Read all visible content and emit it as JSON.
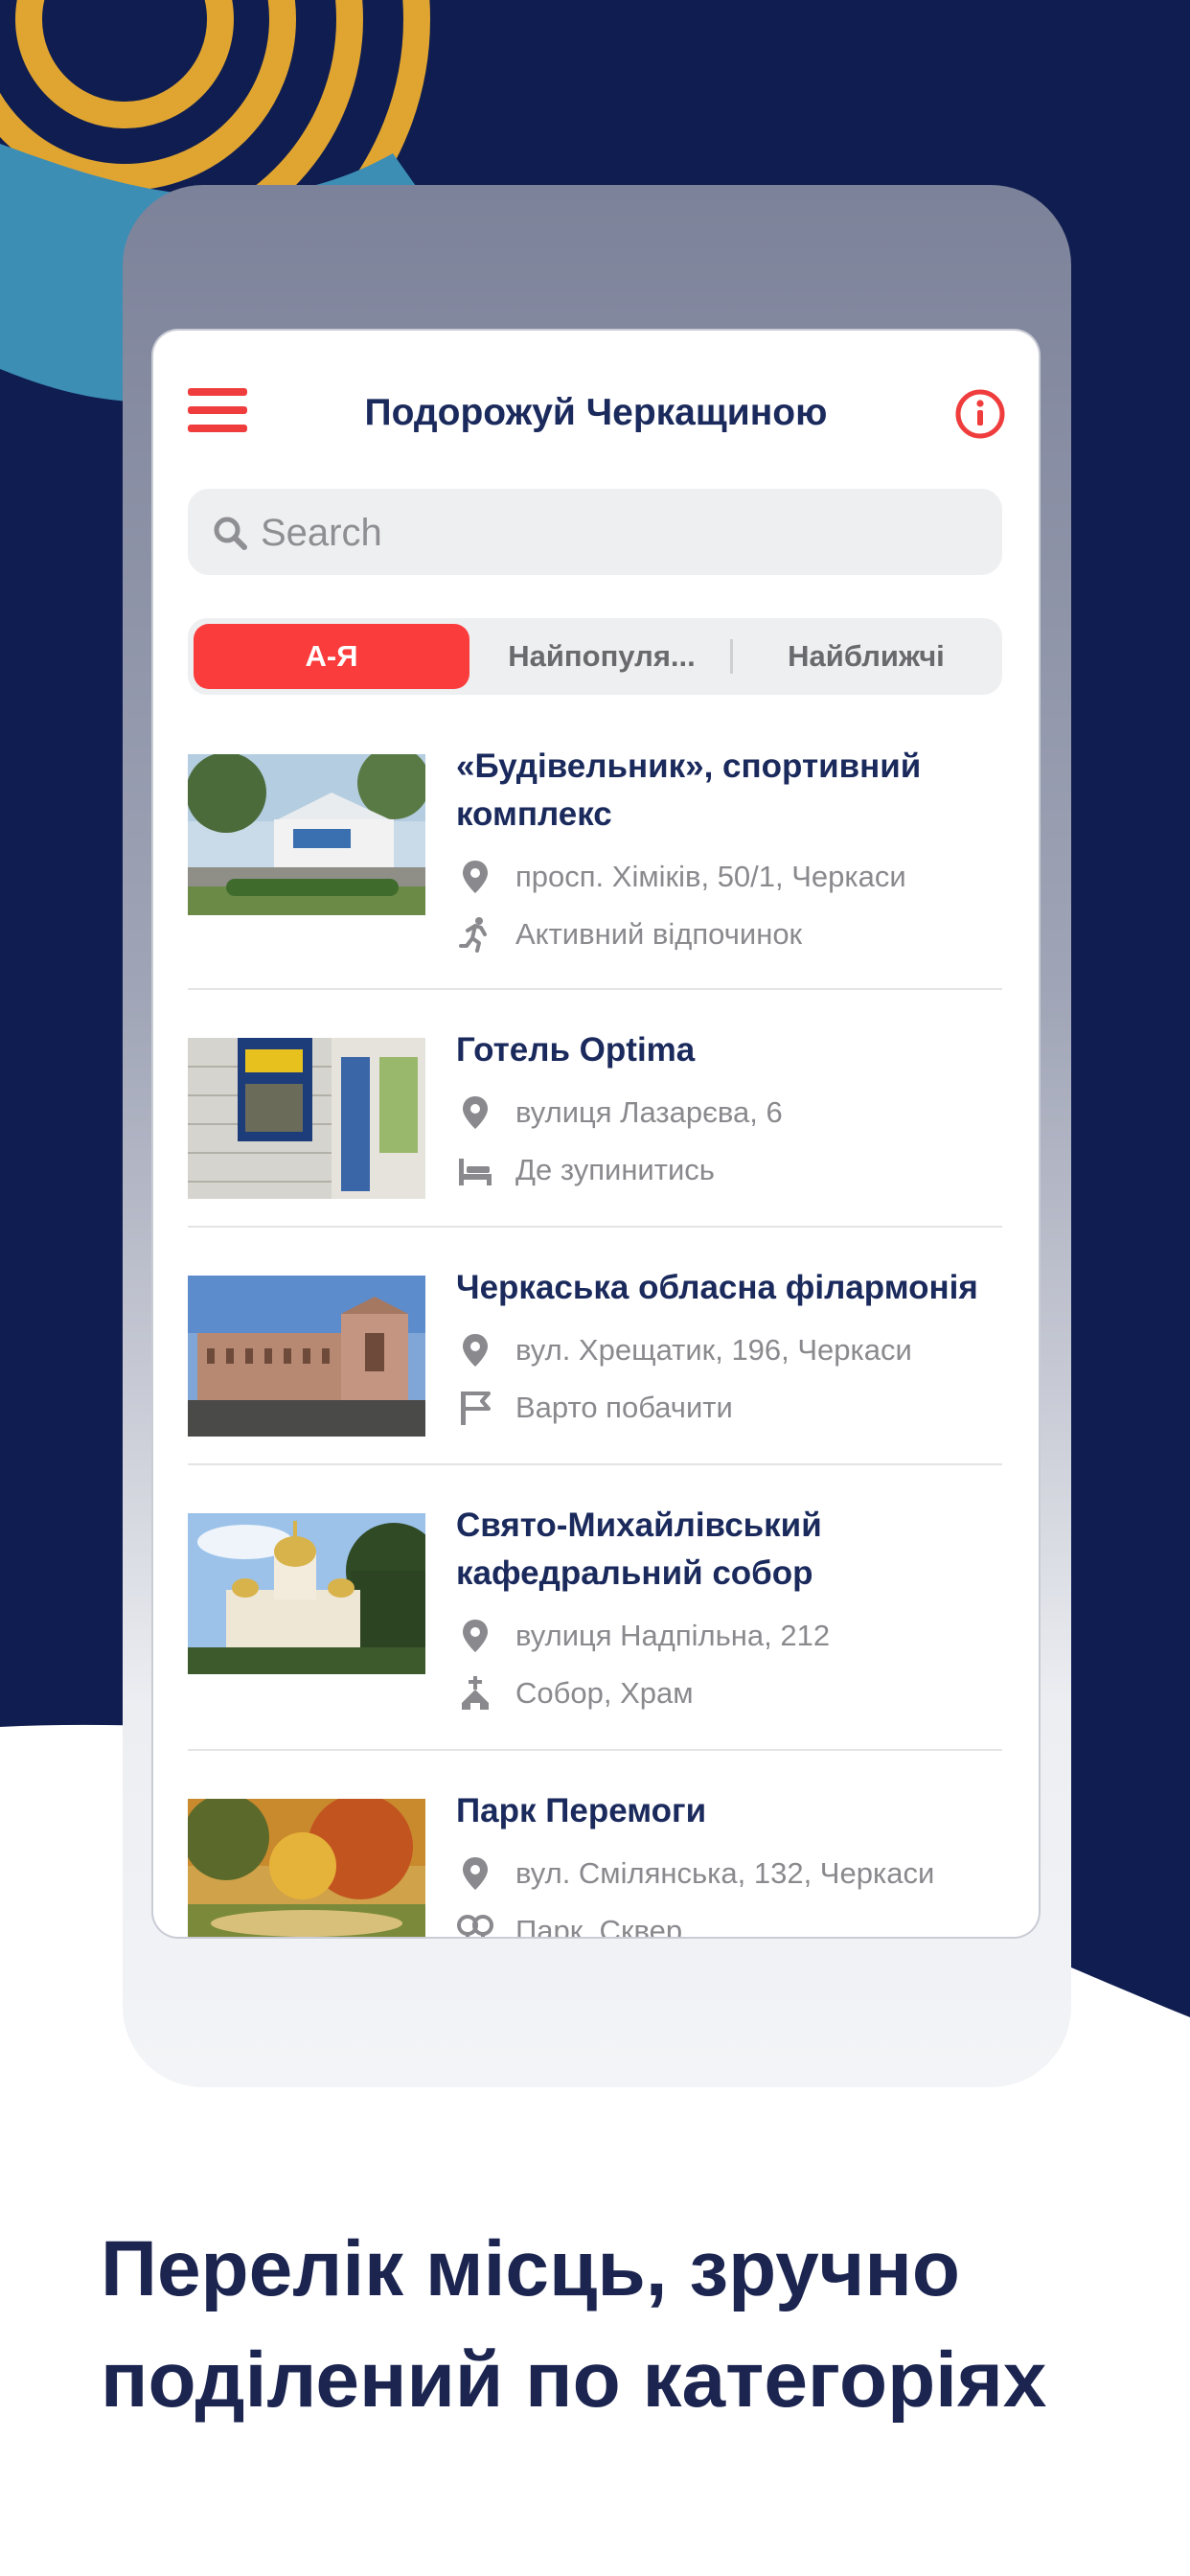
{
  "colors": {
    "navy_background": "#0f1d50",
    "accent_red": "#fb3c3c",
    "title_navy": "#1b2a5c",
    "ring_gold": "#e0a531",
    "ribbon_blue": "#3c8eb5"
  },
  "app": {
    "title": "Подорожуй Черкащиною",
    "menu_icon": "hamburger-icon",
    "info_icon": "info-icon"
  },
  "search": {
    "placeholder": "Search",
    "value": ""
  },
  "segments": {
    "items": [
      "А-Я",
      "Найпопуля...",
      "Найближчі"
    ],
    "selected": "А-Я"
  },
  "places": [
    {
      "title": "«Будівельник», спортивний комплекс",
      "address": "просп. Хіміків, 50/1, Черкаси",
      "category": "Активний відпочинок",
      "category_icon": "running-person-icon"
    },
    {
      "title": "Готель Optima",
      "address": "вулиця Лазарєва, 6",
      "category": "Де зупинитись",
      "category_icon": "bed-icon"
    },
    {
      "title": "Черкаська обласна філармонія",
      "address": "вул. Хрещатик, 196, Черкаси",
      "category": "Варто побачити",
      "category_icon": "flag-icon"
    },
    {
      "title": "Свято-Михайлівський кафедральний собор",
      "address": "вулиця Надпільна, 212",
      "category": "Собор, Храм",
      "category_icon": "church-icon"
    },
    {
      "title": "Парк Перемоги",
      "address": "вул. Смілянська, 132, Черкаси",
      "category": "Парк, Сквер",
      "category_icon": "trees-icon"
    }
  ],
  "marketing": {
    "headline_line1": "Перелік місць, зручно",
    "headline_line2": "поділений по категоріях"
  }
}
